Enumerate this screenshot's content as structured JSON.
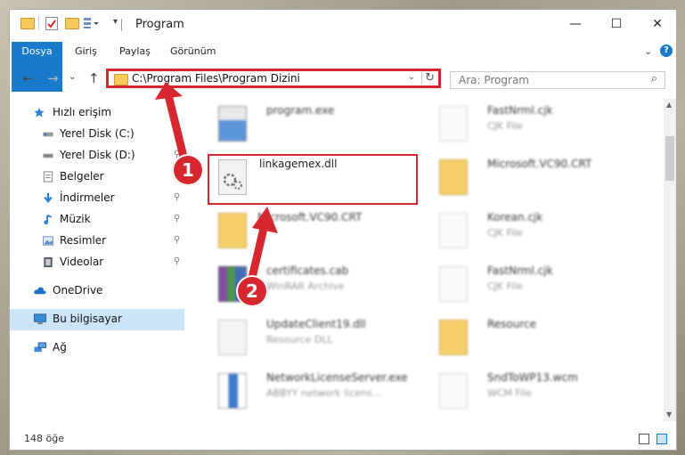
{
  "window": {
    "title": "Program",
    "minimize": "—",
    "maximize": "☐",
    "close": "✕"
  },
  "ribbon": {
    "tabs": [
      "Dosya",
      "Giriş",
      "Paylaş",
      "Görünüm"
    ],
    "expand": "⌄",
    "help": "?"
  },
  "nav": {
    "back": "←",
    "forward": "→",
    "recent": "⌄",
    "up": "↑",
    "address": "C:\\Program Files\\Program Dizini",
    "address_dropdown": "⌄",
    "refresh": "↻",
    "search_placeholder": "Ara: Program",
    "search_icon": "⌕"
  },
  "sidebar": {
    "items": [
      {
        "label": "Hızlı erişim",
        "icon": "star-icon"
      },
      {
        "label": "Yerel Disk (C:)",
        "icon": "drive-icon"
      },
      {
        "label": "Yerel Disk (D:)",
        "icon": "drive-icon"
      },
      {
        "label": "Belgeler",
        "icon": "documents-icon"
      },
      {
        "label": "İndirmeler",
        "icon": "download-icon"
      },
      {
        "label": "Müzik",
        "icon": "music-icon"
      },
      {
        "label": "Resimler",
        "icon": "pictures-icon"
      },
      {
        "label": "Videolar",
        "icon": "video-icon"
      },
      {
        "label": "OneDrive",
        "icon": "cloud-icon"
      },
      {
        "label": "Bu bilgisayar",
        "icon": "computer-icon"
      },
      {
        "label": "Ağ",
        "icon": "network-icon"
      }
    ],
    "pin_glyph": "⚲"
  },
  "files": [
    {
      "name": "program.exe",
      "type": ""
    },
    {
      "name": "FastNrml.cjk",
      "type": "CJK File"
    },
    {
      "name": "linkagemex.dll",
      "type": ""
    },
    {
      "name": "Microsoft.VC90.CRT",
      "type": ""
    },
    {
      "name": "Microsoft.VC90.CRT",
      "type": ""
    },
    {
      "name": "Korean.cjk",
      "type": "CJK File"
    },
    {
      "name": "certificates.cab",
      "type": "WinRAR Archive"
    },
    {
      "name": "FastNrml.cjk",
      "type": "CJK File"
    },
    {
      "name": "UpdateClient19.dll",
      "type": "Resource DLL"
    },
    {
      "name": "Resource",
      "type": ""
    },
    {
      "name": "NetworkLicenseServer.exe",
      "type": "ABBYY network licens..."
    },
    {
      "name": "SndToWP13.wcm",
      "type": "WCM File"
    }
  ],
  "annotations": {
    "badge1": "1",
    "badge2": "2"
  },
  "status": {
    "count": "148 öğe"
  },
  "colors": {
    "accent": "#1979ca",
    "highlight": "#d6272f",
    "selected": "#cce4f7"
  }
}
